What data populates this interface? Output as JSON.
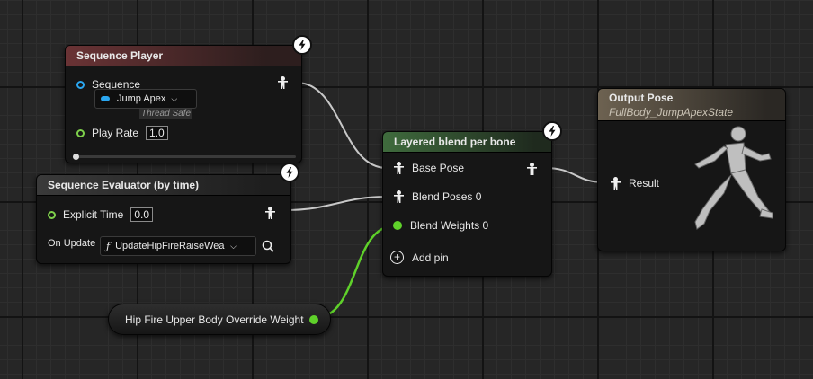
{
  "sequence_player": {
    "title": "Sequence Player",
    "sequence_label": "Sequence",
    "sequence_value": "Jump Apex",
    "thread_safe": "Thread Safe",
    "play_rate_label": "Play Rate",
    "play_rate_value": "1.0"
  },
  "sequence_evaluator": {
    "title": "Sequence Evaluator (by time)",
    "explicit_time_label": "Explicit Time",
    "explicit_time_value": "0.0",
    "on_update_label": "On Update",
    "on_update_value": "UpdateHipFireRaiseWea"
  },
  "layered_blend": {
    "title": "Layered blend per bone",
    "base_pose": "Base Pose",
    "blend_poses": "Blend Poses 0",
    "blend_weights": "Blend Weights 0",
    "add_pin": "Add pin"
  },
  "output_pose": {
    "title": "Output Pose",
    "subtitle": "FullBody_JumpApexState",
    "result": "Result"
  },
  "variable_node": {
    "label": "Hip Fire Upper Body Override Weight"
  },
  "colors": {
    "pose_wire": "#c8c8c8",
    "float_wire": "#5fd12a",
    "object_pin": "#2aa6f0"
  }
}
